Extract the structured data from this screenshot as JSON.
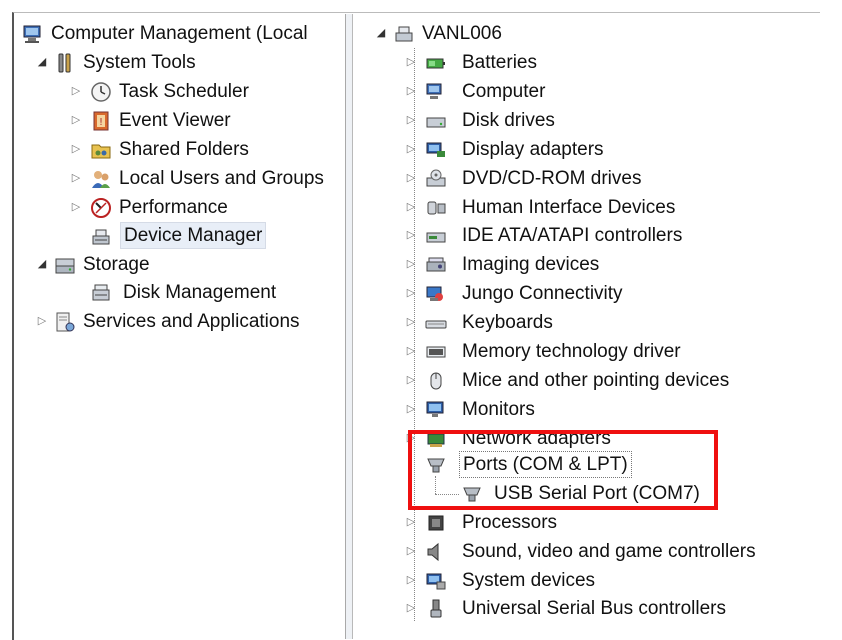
{
  "left_tree": {
    "root": "Computer Management (Local",
    "system_tools": "System Tools",
    "task_scheduler": "Task Scheduler",
    "event_viewer": "Event Viewer",
    "shared_folders": "Shared Folders",
    "local_users": "Local Users and Groups",
    "performance": "Performance",
    "device_manager": "Device Manager",
    "storage": "Storage",
    "disk_management": "Disk Management",
    "services": "Services and Applications"
  },
  "right_tree": {
    "root": "VANL006",
    "items": [
      "Batteries",
      "Computer",
      "Disk drives",
      "Display adapters",
      "DVD/CD-ROM drives",
      "Human Interface Devices",
      "IDE ATA/ATAPI controllers",
      "Imaging devices",
      "Jungo Connectivity",
      "Keyboards",
      "Memory technology driver",
      "Mice and other pointing devices",
      "Monitors",
      "Network adapters"
    ],
    "ports": "Ports (COM & LPT)",
    "usb_serial": "USB Serial Port (COM7)",
    "items_after": [
      "Processors",
      "Sound, video and game controllers",
      "System devices",
      "Universal Serial Bus controllers"
    ]
  },
  "colors": {
    "highlight_box": "#ef1010",
    "selection": "#e8eef7"
  }
}
